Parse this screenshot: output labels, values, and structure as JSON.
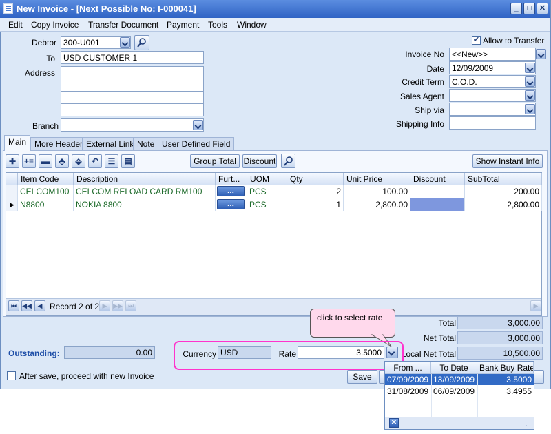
{
  "window": {
    "title": "New Invoice - [Next Possible No: I-000041]"
  },
  "menu": [
    "Edit",
    "Copy Invoice",
    "Transfer Document",
    "Payment",
    "Tools",
    "Window"
  ],
  "header": {
    "debtor_label": "Debtor",
    "debtor_value": "300-U001",
    "to_label": "To",
    "to_value": "USD CUSTOMER 1",
    "address_label": "Address",
    "branch_label": "Branch",
    "allow_transfer": "Allow to Transfer",
    "invoice_no_label": "Invoice No",
    "invoice_no_value": "<<New>>",
    "date_label": "Date",
    "date_value": "12/09/2009",
    "credit_term_label": "Credit Term",
    "credit_term_value": "C.O.D.",
    "sales_agent_label": "Sales Agent",
    "ship_via_label": "Ship via",
    "shipping_info_label": "Shipping Info"
  },
  "tabs": [
    "Main",
    "More Header",
    "External Link",
    "Note",
    "User Defined Field"
  ],
  "toolbar": {
    "group_total": "Group Total",
    "discount": "Discount",
    "show_instant_info": "Show Instant Info"
  },
  "grid": {
    "columns": [
      "Item Code",
      "Description",
      "Furt...",
      "UOM",
      "Qty",
      "Unit Price",
      "Discount",
      "SubTotal"
    ],
    "rows": [
      {
        "item_code": "CELCOM100",
        "description": "CELCOM RELOAD CARD RM100",
        "further": "...",
        "uom": "PCS",
        "qty": "2",
        "unit_price": "100.00",
        "discount": "",
        "subtotal": "200.00"
      },
      {
        "item_code": "N8800",
        "description": "NOKIA 8800",
        "further": "...",
        "uom": "PCS",
        "qty": "1",
        "unit_price": "2,800.00",
        "discount": "",
        "subtotal": "2,800.00"
      }
    ],
    "record_text": "Record 2 of 2"
  },
  "callout": {
    "text": "click to select rate"
  },
  "footer": {
    "outstanding_label": "Outstanding:",
    "outstanding_value": "0.00",
    "currency_label": "Currency",
    "currency_value": "USD",
    "rate_label": "Rate",
    "rate_value": "3.5000",
    "total_label": "Total",
    "total_value": "3,000.00",
    "net_total_label": "Net Total",
    "net_total_value": "3,000.00",
    "local_net_total_label": "Local Net Total",
    "local_net_total_value": "10,500.00",
    "after_save": "After save, proceed with new Invoice",
    "save": "Save"
  },
  "rate_popup": {
    "columns": [
      "From ...",
      "To Date",
      "Bank Buy Rate"
    ],
    "rows": [
      {
        "from": "07/09/2009",
        "to": "13/09/2009",
        "rate": "3.5000"
      },
      {
        "from": "31/08/2009",
        "to": "06/09/2009",
        "rate": "3.4955"
      }
    ]
  },
  "colors": {
    "highlight": "#ff33cc",
    "selection": "#316ac5",
    "outstanding_label": "#1f4fa8"
  }
}
